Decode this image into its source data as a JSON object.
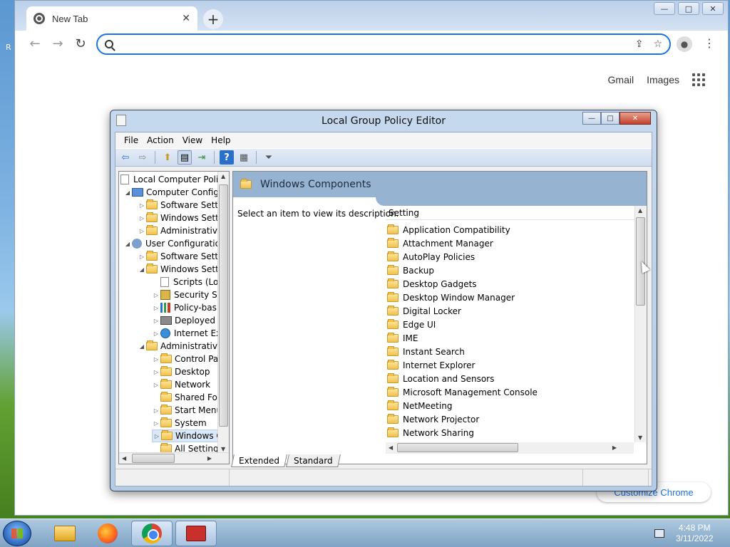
{
  "desktop": {
    "edge_label": "R"
  },
  "chrome": {
    "tab_title": "New Tab",
    "tab_close": "✕",
    "new_tab": "+",
    "win_min": "—",
    "win_max": "□",
    "win_close": "✕",
    "back": "←",
    "forward": "→",
    "reload": "↻",
    "omnibox_value": "",
    "share_glyph": "⇪",
    "star_glyph": "☆",
    "profile_glyph": "●",
    "menu_glyph": "⋮",
    "links": {
      "gmail": "Gmail",
      "images": "Images"
    },
    "customize": "Customize Chrome"
  },
  "gpedit": {
    "title": "Local Group Policy Editor",
    "win_min": "—",
    "win_max": "□",
    "win_close": "✕",
    "menu": [
      "File",
      "Action",
      "View",
      "Help"
    ],
    "toolbar_glyphs": {
      "back": "⇦",
      "forward": "⇨",
      "up": "⬆",
      "show": "▤",
      "export": "⇥",
      "help": "?",
      "props": "▦",
      "filter": "⏷"
    },
    "tree": [
      {
        "label": "Local Computer Polic"
      },
      {
        "label": "Computer Config"
      },
      {
        "label": "Software Setti"
      },
      {
        "label": "Windows Sett"
      },
      {
        "label": "Administrative"
      },
      {
        "label": "User Configuratio"
      },
      {
        "label": "Software Setti"
      },
      {
        "label": "Windows Sett"
      },
      {
        "label": "Scripts (Lo"
      },
      {
        "label": "Security Se"
      },
      {
        "label": "Policy-bas"
      },
      {
        "label": "Deployed"
      },
      {
        "label": "Internet Ex"
      },
      {
        "label": "Administrativ"
      },
      {
        "label": "Control Pa"
      },
      {
        "label": "Desktop"
      },
      {
        "label": "Network"
      },
      {
        "label": "Shared Fol"
      },
      {
        "label": "Start Menu"
      },
      {
        "label": "System"
      },
      {
        "label": "Windows C"
      },
      {
        "label": "All Setting"
      }
    ],
    "right_title": "Windows Components",
    "description": "Select an item to view its description.",
    "column_header": "Setting",
    "settings": [
      "Application Compatibility",
      "Attachment Manager",
      "AutoPlay Policies",
      "Backup",
      "Desktop Gadgets",
      "Desktop Window Manager",
      "Digital Locker",
      "Edge UI",
      "IME",
      "Instant Search",
      "Internet Explorer",
      "Location and Sensors",
      "Microsoft Management Console",
      "NetMeeting",
      "Network Projector",
      "Network Sharing"
    ],
    "view_tabs": [
      "Extended",
      "Standard"
    ]
  },
  "taskbar": {
    "time": "4:48 PM",
    "date": "3/11/2022"
  }
}
